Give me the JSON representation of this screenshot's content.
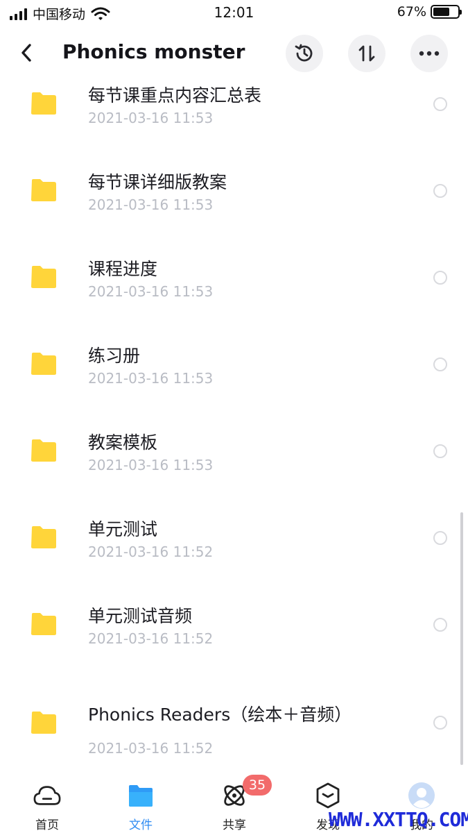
{
  "status_bar": {
    "carrier": "中国移动",
    "time": "12:01",
    "battery_percent": "67%",
    "battery_level": 0.67,
    "signal_icon": "cellular-signal-icon",
    "wifi_icon": "wifi-icon"
  },
  "nav": {
    "title": "Phonics monster",
    "back_icon": "chevron-left-icon",
    "history_icon": "history-icon",
    "sort_icon": "sort-icon",
    "more_icon": "more-horizontal-icon"
  },
  "files": [
    {
      "name": "每节课重点内容汇总表",
      "date": "2021-03-16 11:53"
    },
    {
      "name": "每节课详细版教案",
      "date": "2021-03-16 11:53"
    },
    {
      "name": "课程进度",
      "date": "2021-03-16 11:53"
    },
    {
      "name": "练习册",
      "date": "2021-03-16 11:53"
    },
    {
      "name": "教案模板",
      "date": "2021-03-16 11:53"
    },
    {
      "name": "单元测试",
      "date": "2021-03-16 11:52"
    },
    {
      "name": "单元测试音频",
      "date": "2021-03-16 11:52"
    },
    {
      "name": "Phonics Readers（绘本＋音频）",
      "date": "2021-03-16 11:52"
    }
  ],
  "tabs": [
    {
      "label": "首页",
      "icon": "cloud-icon"
    },
    {
      "label": "文件",
      "icon": "folder-icon"
    },
    {
      "label": "共享",
      "icon": "share-orbit-icon"
    },
    {
      "label": "发现",
      "icon": "discover-cube-icon"
    },
    {
      "label": "我的",
      "icon": "avatar-icon"
    }
  ],
  "share_badge": "35",
  "watermark": "WWW.XXTTQ.COM",
  "colors": {
    "folder": "#ffd53a",
    "accent": "#2f8cf2",
    "badge": "#f26b6b",
    "date_text": "#b9bcc4"
  }
}
